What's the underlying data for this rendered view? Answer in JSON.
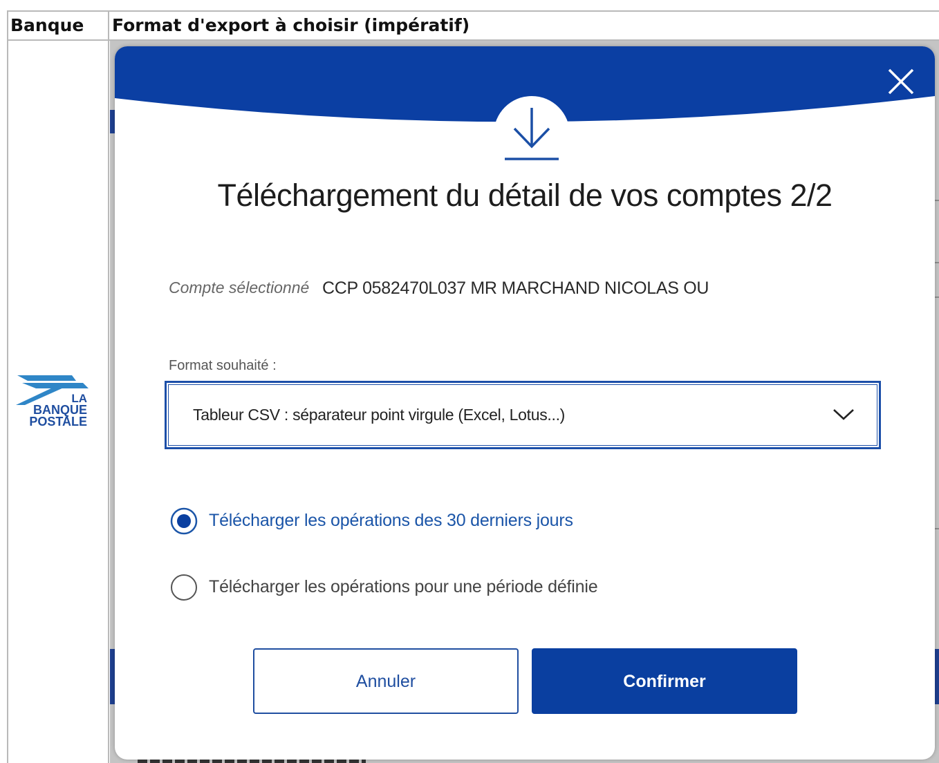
{
  "table": {
    "header_bank": "Banque",
    "header_format": "Format d'export à choisir (impératif)"
  },
  "bank_logo": {
    "line1": "LA",
    "line2": "BANQUE",
    "line3": "POSTALE"
  },
  "modal": {
    "title": "Téléchargement du détail de vos comptes 2/2",
    "account_label": "Compte sélectionné",
    "account_value": "CCP 0582470L037 MR MARCHAND NICOLAS OU",
    "format_label": "Format souhaité :",
    "format_selected": "Tableur CSV : séparateur point virgule (Excel, Lotus...)",
    "radio_options": [
      {
        "label": "Télécharger les opérations des 30 derniers jours",
        "selected": true
      },
      {
        "label": "Télécharger les opérations pour une période définie",
        "selected": false
      }
    ],
    "cancel_label": "Annuler",
    "confirm_label": "Confirmer"
  },
  "icons": {
    "close": "close-icon",
    "download": "download-icon",
    "chevron": "chevron-down-icon"
  },
  "colors": {
    "brand_blue": "#0a3fa0",
    "header_blue": "#0b3fa3",
    "selected_text": "#1b55a8",
    "unselected_text": "#444444"
  }
}
